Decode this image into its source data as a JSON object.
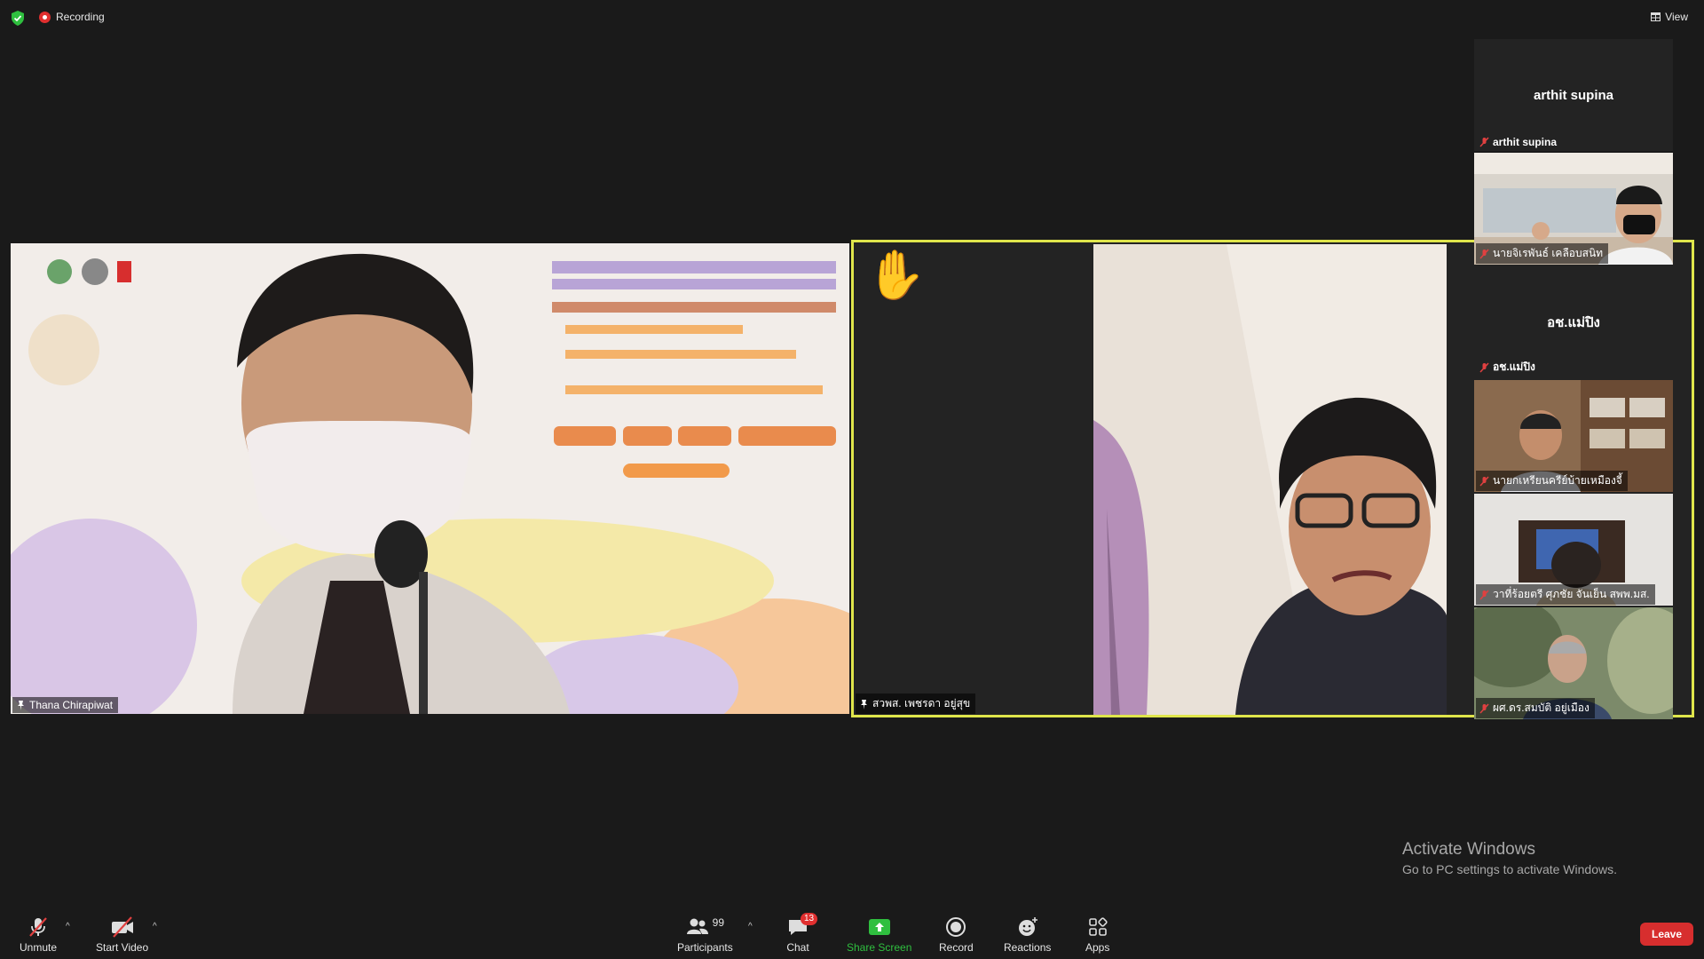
{
  "top": {
    "recording": "Recording",
    "view": "View"
  },
  "main_tiles": [
    {
      "name": "Thana Chirapiwat"
    },
    {
      "name": "สวพส. เพชรดา อยู่สุข"
    }
  ],
  "sidebar": [
    {
      "name": "arthit supina",
      "type": "name_only"
    },
    {
      "name": "นายจิเรพันธ์ เคลือบสนิท",
      "type": "video"
    },
    {
      "name": "อช.แม่ปิง",
      "type": "name_only"
    },
    {
      "name": "นายกเหรียนครีย์บ้ายเหมืองจี้",
      "type": "video"
    },
    {
      "name": "วาที่ร้อยตรี ศุภชัย จันเย็น สพพ.มส.",
      "type": "video"
    },
    {
      "name": "ผศ.ดร.สมบัติ อยู่เมือง",
      "type": "video"
    }
  ],
  "toolbar": {
    "unmute": "Unmute",
    "start_video": "Start Video",
    "participants": "Participants",
    "participants_count": "99",
    "chat": "Chat",
    "chat_badge": "13",
    "share": "Share Screen",
    "record": "Record",
    "reactions": "Reactions",
    "apps": "Apps",
    "leave": "Leave"
  },
  "watermark": {
    "line1": "Activate Windows",
    "line2": "Go to PC settings to activate Windows."
  },
  "colors": {
    "active_speaker_border": "#dfe54b",
    "leave": "#d72e2e",
    "share": "#2fbf3f"
  }
}
